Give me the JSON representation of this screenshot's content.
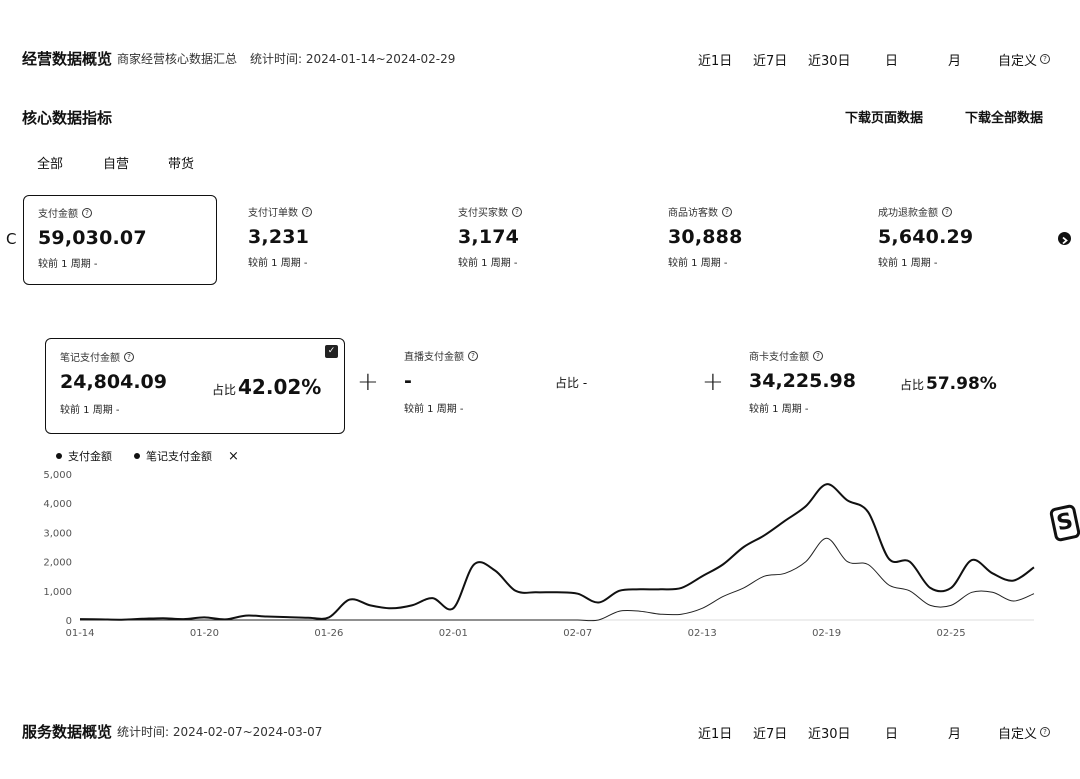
{
  "header": {
    "title": "经营数据概览",
    "subtitle": "商家经营核心数据汇总",
    "time_label": "统计时间: 2024-01-14~2024-02-29",
    "ranges": [
      "近1日",
      "近7日",
      "近30日",
      "日",
      "月",
      "自定义"
    ]
  },
  "core": {
    "title": "核心数据指标",
    "download_page": "下载页面数据",
    "download_all": "下载全部数据",
    "tabs": [
      "全部",
      "自营",
      "带货"
    ]
  },
  "metrics": [
    {
      "label": "支付金额",
      "value": "59,030.07",
      "compare": "较前 1 周期 -"
    },
    {
      "label": "支付订单数",
      "value": "3,231",
      "compare": "较前 1 周期 -"
    },
    {
      "label": "支付买家数",
      "value": "3,174",
      "compare": "较前 1 周期 -"
    },
    {
      "label": "商品访客数",
      "value": "30,888",
      "compare": "较前 1 周期 -"
    },
    {
      "label": "成功退款金额",
      "value": "5,640.29",
      "compare": "较前 1 周期 -"
    }
  ],
  "nav": {
    "prev": "C"
  },
  "breakdown": [
    {
      "label": "笔记支付金额",
      "value": "24,804.09",
      "share_label": "占比",
      "share": "42.02%",
      "compare": "较前 1 周期 -"
    },
    {
      "label": "直播支付金额",
      "value": "-",
      "share_label": "占比",
      "share": "-",
      "compare": "较前 1 周期 -"
    },
    {
      "label": "商卡支付金额",
      "value": "34,225.98",
      "share_label": "占比",
      "share": "57.98%",
      "compare": "较前 1 周期 -"
    }
  ],
  "symbols": {
    "plus": "+",
    "close": "×",
    "question": "?",
    "check": "✓",
    "brand": "S"
  },
  "legend": [
    "支付金额",
    "笔记支付金额"
  ],
  "chart_data": {
    "type": "line",
    "x": [
      "01-14",
      "01-15",
      "01-16",
      "01-17",
      "01-18",
      "01-19",
      "01-20",
      "01-21",
      "01-22",
      "01-23",
      "01-24",
      "01-25",
      "01-26",
      "01-27",
      "01-28",
      "01-29",
      "01-30",
      "01-31",
      "02-01",
      "02-02",
      "02-03",
      "02-04",
      "02-05",
      "02-06",
      "02-07",
      "02-08",
      "02-09",
      "02-10",
      "02-11",
      "02-12",
      "02-13",
      "02-14",
      "02-15",
      "02-16",
      "02-17",
      "02-18",
      "02-19",
      "02-20",
      "02-21",
      "02-22",
      "02-23",
      "02-24",
      "02-25",
      "02-26",
      "02-27",
      "02-28",
      "02-29"
    ],
    "xticks": [
      "01-14",
      "01-20",
      "01-26",
      "02-01",
      "02-07",
      "02-13",
      "02-19",
      "02-25"
    ],
    "yticks": [
      "0",
      "1,000",
      "2,000",
      "3,000",
      "4,000",
      "5,000"
    ],
    "ylim": [
      0,
      5000
    ],
    "series": [
      {
        "name": "支付金额",
        "values": [
          30,
          20,
          10,
          40,
          60,
          30,
          90,
          20,
          150,
          120,
          100,
          80,
          90,
          700,
          500,
          400,
          500,
          750,
          400,
          1900,
          1700,
          1000,
          950,
          950,
          900,
          600,
          1000,
          1050,
          1050,
          1100,
          1500,
          1900,
          2500,
          2900,
          3400,
          3900,
          4650,
          4100,
          3700,
          2100,
          2000,
          1100,
          1100,
          2050,
          1600,
          1350,
          1800
        ]
      },
      {
        "name": "笔记支付金额",
        "values": [
          0,
          0,
          0,
          0,
          0,
          0,
          0,
          0,
          0,
          0,
          0,
          0,
          0,
          0,
          0,
          0,
          0,
          0,
          0,
          0,
          0,
          0,
          0,
          0,
          0,
          0,
          300,
          300,
          200,
          200,
          400,
          800,
          1100,
          1500,
          1600,
          2000,
          2800,
          2000,
          1900,
          1200,
          1000,
          500,
          500,
          950,
          950,
          650,
          900
        ]
      }
    ]
  },
  "service": {
    "title": "服务数据概览",
    "time_label": "统计时间: 2024-02-07~2024-03-07",
    "ranges": [
      "近1日",
      "近7日",
      "近30日",
      "日",
      "月",
      "自定义"
    ]
  }
}
